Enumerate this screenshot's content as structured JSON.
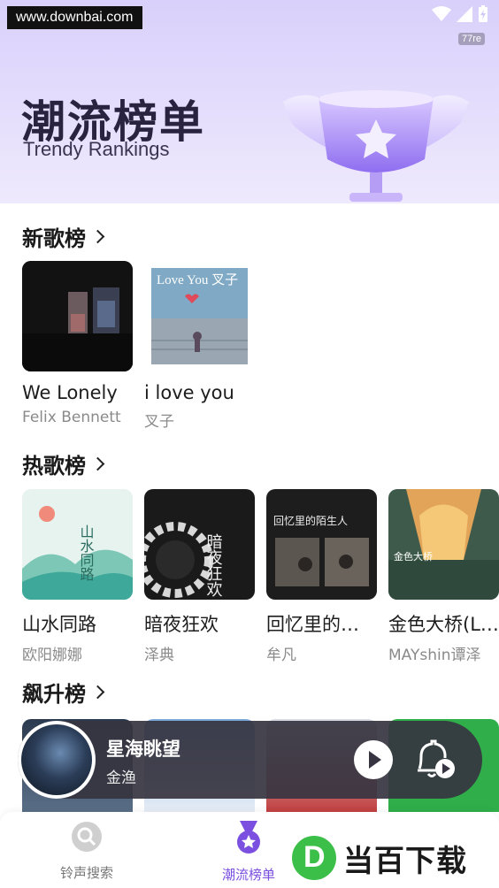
{
  "status_bar": {
    "url_watermark": "www.downbai.com",
    "tag": "77re"
  },
  "hero": {
    "title": "潮流榜单",
    "subtitle": "Trendy Rankings",
    "icon": "trophy-icon"
  },
  "sections": [
    {
      "title": "新歌榜",
      "songs": [
        {
          "name": "We Lonely",
          "artist": "Felix Bennett",
          "cover_text": ""
        },
        {
          "name": "i love you",
          "artist": "叉子",
          "cover_text": "Love You 叉子"
        }
      ]
    },
    {
      "title": "热歌榜",
      "songs": [
        {
          "name": "山水同路",
          "artist": "欧阳娜娜",
          "cover_text": "山水同路"
        },
        {
          "name": "暗夜狂欢",
          "artist": "泽典",
          "cover_text": "暗夜狂欢"
        },
        {
          "name": "回忆里的陌生人",
          "artist": "牟凡",
          "cover_text": "回忆里的陌生人"
        },
        {
          "name": "金色大桥(Live)",
          "artist": "MAYshin谭泽",
          "cover_text": "金色大桥"
        }
      ]
    },
    {
      "title": "飙升榜",
      "songs": []
    }
  ],
  "player": {
    "song": "星海眺望",
    "artist": "金渔"
  },
  "tabs": [
    {
      "label": "铃声搜索",
      "icon": "search-icon",
      "active": false
    },
    {
      "label": "潮流榜单",
      "icon": "ranking-medal-icon",
      "active": true
    }
  ],
  "watermark": {
    "text": "当百下载",
    "letter": "D"
  },
  "colors": {
    "accent": "#7b4fe0",
    "hero_bg": "#ddd3fb",
    "player_bg": "#363440"
  }
}
